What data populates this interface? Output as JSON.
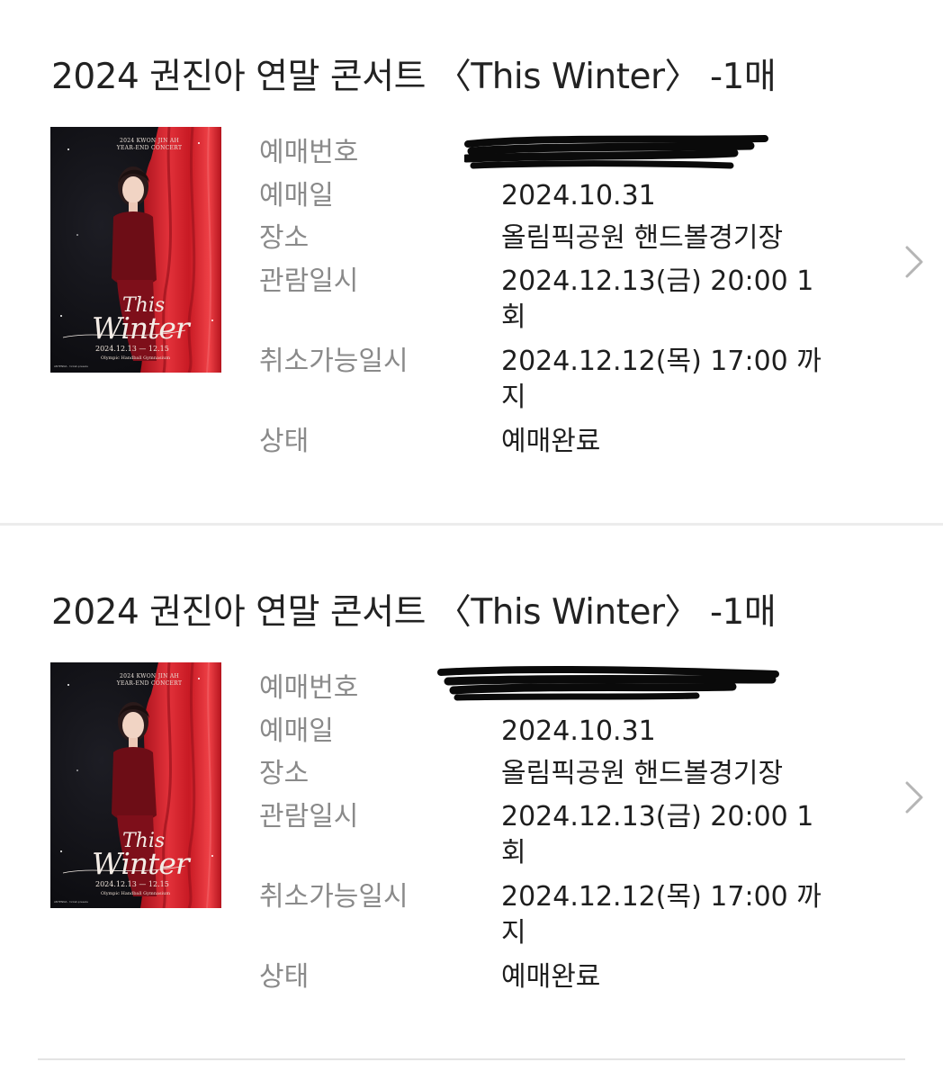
{
  "bookings": [
    {
      "title": "2024 권진아 연말 콘서트 〈This Winter〉 -1매",
      "poster": {
        "headline_1": "2024 KWON JIN AH",
        "headline_2": "YEAR-END CONCERT",
        "title_1": "This",
        "title_2": "Winter",
        "dates": "2024.12.13 — 12.15",
        "venue": "Olympic Handball Gymnasium",
        "credit": "ANTENNA · ticket-presale"
      },
      "labels": {
        "booking_no": "예매번호",
        "booking_date": "예매일",
        "venue": "장소",
        "show_time": "관람일시",
        "cancel_deadline": "취소가능일시",
        "status": "상태"
      },
      "values": {
        "booking_no": "",
        "booking_date": "2024.10.31",
        "venue": "올림픽공원 핸드볼경기장",
        "show_time": "2024.12.13(금) 20:00 1\n회",
        "cancel_deadline": "2024.12.12(목) 17:00 까\n지",
        "status": "예매완료"
      },
      "chevron_icon": "chevron-right-icon"
    },
    {
      "title": "2024 권진아 연말 콘서트 〈This Winter〉 -1매",
      "poster": {
        "headline_1": "2024 KWON JIN AH",
        "headline_2": "YEAR-END CONCERT",
        "title_1": "This",
        "title_2": "Winter",
        "dates": "2024.12.13 — 12.15",
        "venue": "Olympic Handball Gymnasium",
        "credit": "ANTENNA · ticket-presale"
      },
      "labels": {
        "booking_no": "예매번호",
        "booking_date": "예매일",
        "venue": "장소",
        "show_time": "관람일시",
        "cancel_deadline": "취소가능일시",
        "status": "상태"
      },
      "values": {
        "booking_no": "",
        "booking_date": "2024.10.31",
        "venue": "올림픽공원 핸드볼경기장",
        "show_time": "2024.12.13(금) 20:00 1\n회",
        "cancel_deadline": "2024.12.12(목) 17:00 까\n지",
        "status": "예매완료"
      },
      "chevron_icon": "chevron-right-icon"
    }
  ],
  "colors": {
    "background": "#ffffff",
    "label": "#8a8a8a",
    "value": "#1e1e1e",
    "divider": "#ececec",
    "poster_red": "#d8252e",
    "chevron": "#b5b5b5"
  }
}
